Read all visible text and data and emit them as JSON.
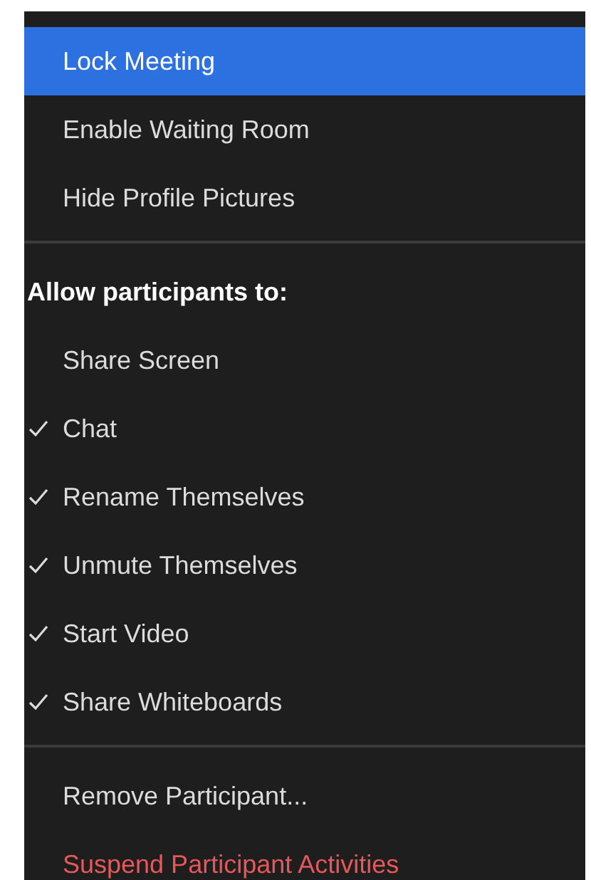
{
  "menu": [
    {
      "kind": "item",
      "label": "Lock Meeting",
      "selected": true
    },
    {
      "kind": "item",
      "label": "Enable Waiting Room",
      "selected": false
    },
    {
      "kind": "item",
      "label": "Hide Profile Pictures",
      "selected": false
    },
    {
      "kind": "separator"
    },
    {
      "kind": "header",
      "label": "Allow participants to:"
    },
    {
      "kind": "check",
      "label": "Share Screen",
      "checked": false
    },
    {
      "kind": "check",
      "label": "Chat",
      "checked": true
    },
    {
      "kind": "check",
      "label": "Rename Themselves",
      "checked": true
    },
    {
      "kind": "check",
      "label": "Unmute Themselves",
      "checked": true
    },
    {
      "kind": "check",
      "label": "Start Video",
      "checked": true
    },
    {
      "kind": "check",
      "label": "Share Whiteboards",
      "checked": true
    },
    {
      "kind": "separator"
    },
    {
      "kind": "item",
      "label": "Remove Participant...",
      "selected": false
    },
    {
      "kind": "danger",
      "label": "Suspend Participant Activities"
    }
  ]
}
